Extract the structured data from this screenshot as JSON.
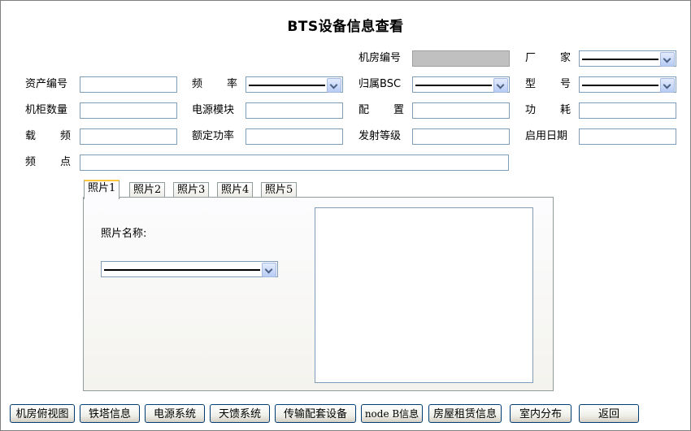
{
  "title": "BTS设备信息查看",
  "fields": {
    "machine_room_no": {
      "label": "机房编号",
      "value": ""
    },
    "vendor": {
      "label": "厂　家",
      "value": ""
    },
    "asset_no": {
      "label": "资产编号",
      "value": ""
    },
    "frequency": {
      "label": "频　率",
      "value": ""
    },
    "belongs_bsc": {
      "label": "归属BSC",
      "value": ""
    },
    "model": {
      "label": "型　号",
      "value": ""
    },
    "cabinet_count": {
      "label": "机柜数量",
      "value": ""
    },
    "power_module": {
      "label": "电源模块",
      "value": ""
    },
    "config": {
      "label": "配　置",
      "value": ""
    },
    "power_consumption": {
      "label": "功　耗",
      "value": ""
    },
    "carrier": {
      "label": "载　频",
      "value": ""
    },
    "rated_power": {
      "label": "额定功率",
      "value": ""
    },
    "tx_level": {
      "label": "发射等级",
      "value": ""
    },
    "start_date": {
      "label": "启用日期",
      "value": ""
    },
    "freq_point": {
      "label": "频　点",
      "value": ""
    }
  },
  "photo_tabs": [
    "照片1",
    "照片2",
    "照片3",
    "照片4",
    "照片5"
  ],
  "active_tab": 0,
  "photo_name_label": "照片名称:",
  "buttons": [
    "机房俯视图",
    "铁塔信息",
    "电源系统",
    "天馈系统",
    "传输配套设备",
    "node B信息",
    "房屋租赁信息",
    "室内分布",
    "返回"
  ]
}
